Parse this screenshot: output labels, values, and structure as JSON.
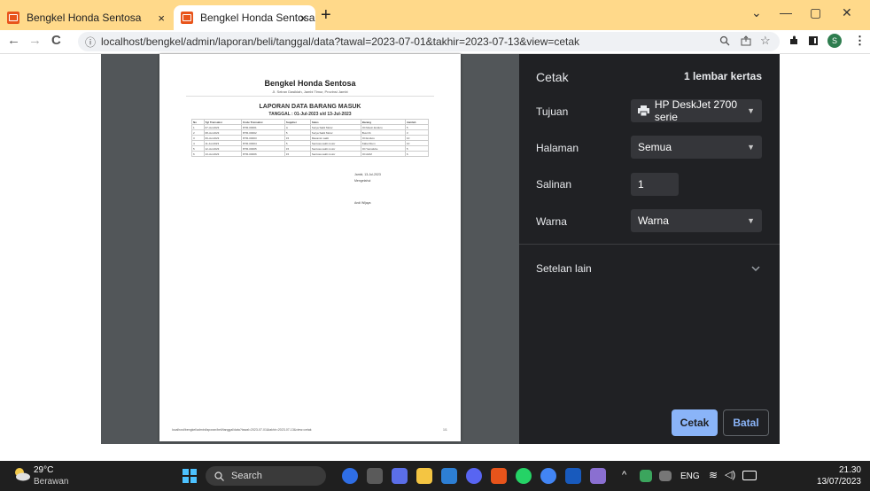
{
  "browser": {
    "tabs": [
      {
        "title": "Bengkel Honda Sentosa",
        "close": "×"
      },
      {
        "title": "Bengkel Honda Sentosa",
        "close": "×"
      }
    ],
    "new_tab": "+",
    "window_controls": {
      "dropdown": "⌄",
      "minimize": "—",
      "restore": "▢",
      "close": "✕"
    },
    "nav": {
      "back": "←",
      "forward": "→",
      "reload": "C"
    },
    "address": {
      "info": "ⓘ",
      "url": "localhost/bengkel/admin/laporan/beli/tanggal/data?tawal=2023-07-01&takhir=2023-07-13&view=cetak"
    },
    "omni_icons": [
      "search-icon",
      "share-icon",
      "star-icon",
      "extensions-icon",
      "sidepanel-icon",
      "profile-icon",
      "menu-icon"
    ],
    "profile_initial": "S"
  },
  "document": {
    "title": "Bengkel Honda Sentosa",
    "address": "Jl. Seiran Dasiklah, Jambi Timur, Provinsi Jambi",
    "report_title": "LAPORAN DATA BARANG MASUK",
    "report_period": "TANGGAL : 01-Jul-2023 s/d 13-Jul-2023",
    "columns": [
      "No",
      "Tgl Transaksi",
      "Kode Transaksi",
      "Supplier",
      "Sales",
      "Barang",
      "Jumlah"
    ],
    "rows": [
      [
        "1",
        "07-Jul-2023",
        "BTR-00001",
        "A",
        "Surya Sakti Motor",
        "Oli Mesin Enduro",
        "5"
      ],
      [
        "2",
        "08-Jul-2023",
        "BTR-00002",
        "5",
        "Surya Sakti Motor",
        "Busi Iib",
        "3"
      ],
      [
        "3",
        "09-Jul-2023",
        "BTR-00003",
        "15",
        "Maxamin sakti",
        "Oli Enduro",
        "10"
      ],
      [
        "4",
        "11-Jul-2023",
        "BTR-00004",
        "5",
        "Sentosa sakti motor",
        "Kabel Rem",
        "10"
      ],
      [
        "5",
        "12-Jul-2023",
        "BTR-00005",
        "15",
        "Sentosa sakti motor",
        "Oli Yamalube",
        "5"
      ],
      [
        "6",
        "13-Jul-2023",
        "BTR-00006",
        "15",
        "Sentosa sakti motor",
        "Oli AHM",
        "6"
      ]
    ],
    "sign_place_date": "Jambi, 13-Jul-2023",
    "sign_role": "Mengetahui",
    "sign_name": "Andi Wijaya",
    "footer_url": "localhost/bengkel/admin/laporan/beli/tanggal/data?tawal=2023-07-01&takhir=2023-07-13&view=cetak",
    "page_number": "1/1"
  },
  "print_panel": {
    "heading": "Cetak",
    "sheets": "1 lembar kertas",
    "destination_label": "Tujuan",
    "destination_value": "HP DeskJet 2700 serie",
    "pages_label": "Halaman",
    "pages_value": "Semua",
    "copies_label": "Salinan",
    "copies_value": "1",
    "color_label": "Warna",
    "color_value": "Warna",
    "more_settings": "Setelan lain",
    "print_button": "Cetak",
    "cancel_button": "Batal"
  },
  "taskbar": {
    "weather_temp": "29°C",
    "weather_desc": "Berawan",
    "search_placeholder": "Search",
    "language": "ENG",
    "time": "21.30",
    "date": "13/07/2023"
  },
  "colors": {
    "tabbar": "#ffd98a",
    "panel_bg": "#202124",
    "accent": "#8ab4f8",
    "taskbar": "#1f1f1f"
  }
}
